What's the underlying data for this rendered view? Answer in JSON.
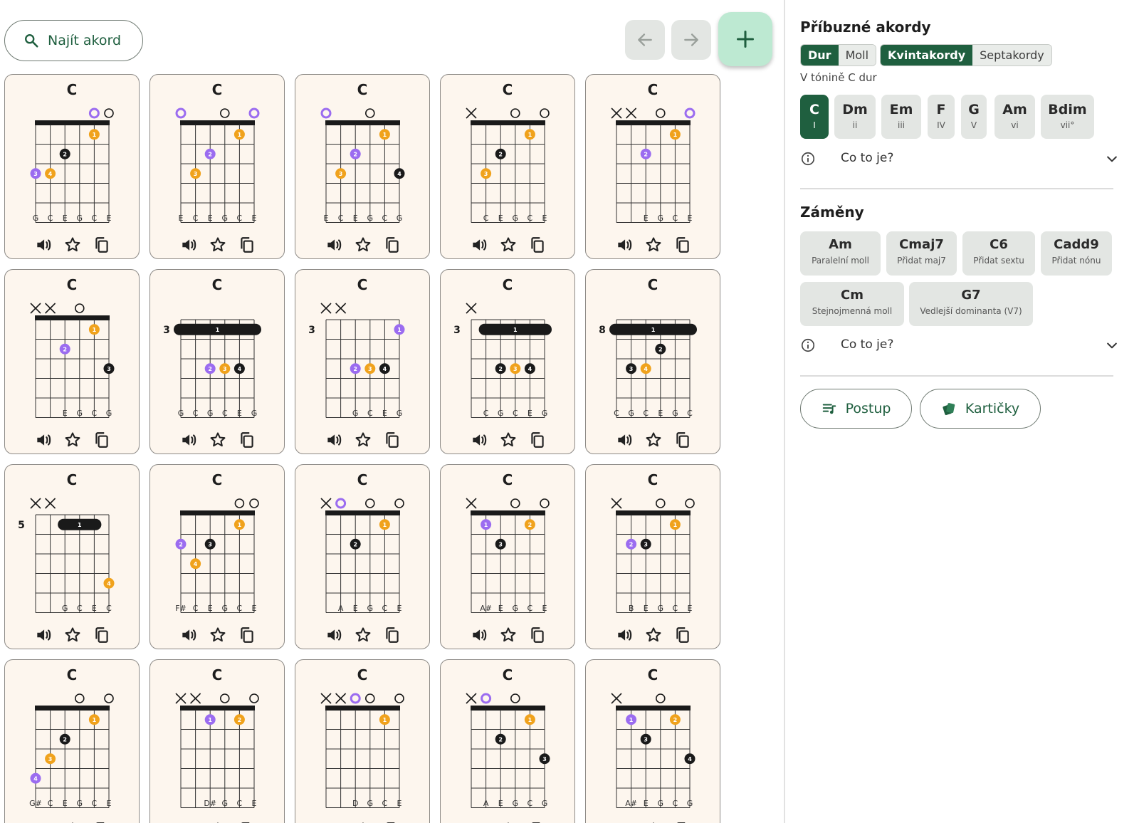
{
  "toolbar": {
    "search_label": "Najít akord",
    "search_icon": "magnifier-icon",
    "back_icon": "arrow-left-icon",
    "forward_icon": "arrow-right-icon",
    "add_icon": "plus-icon"
  },
  "colors": {
    "accent": "#1f5f3f",
    "finger_1": "#f0a21c",
    "finger_2": "#9b6cf0",
    "finger_3": "#1a1a1a",
    "open_root": "#9b6cf0",
    "card_bg": "#fdf6ee"
  },
  "chords": [
    {
      "name": "C",
      "base": "",
      "strings": [
        "G",
        "C",
        "E",
        "G",
        "C",
        "E"
      ],
      "top": [
        "",
        "",
        "",
        "",
        "R",
        "O"
      ],
      "barre": null,
      "dots": [
        {
          "s": 5,
          "f": 1,
          "n": "1",
          "c": "o"
        },
        {
          "s": 3,
          "f": 2,
          "n": "2",
          "c": "k"
        },
        {
          "s": 1,
          "f": 3,
          "n": "3",
          "c": "p"
        },
        {
          "s": 2,
          "f": 3,
          "n": "4",
          "c": "o"
        }
      ]
    },
    {
      "name": "C",
      "base": "",
      "strings": [
        "E",
        "C",
        "E",
        "G",
        "C",
        "E"
      ],
      "top": [
        "R",
        "",
        "",
        "O",
        "",
        "R"
      ],
      "barre": null,
      "dots": [
        {
          "s": 5,
          "f": 1,
          "n": "1",
          "c": "o"
        },
        {
          "s": 3,
          "f": 2,
          "n": "2",
          "c": "p"
        },
        {
          "s": 2,
          "f": 3,
          "n": "3",
          "c": "o"
        }
      ]
    },
    {
      "name": "C",
      "base": "",
      "strings": [
        "E",
        "C",
        "E",
        "G",
        "C",
        "G"
      ],
      "top": [
        "R",
        "",
        "",
        "O",
        "",
        ""
      ],
      "barre": null,
      "dots": [
        {
          "s": 5,
          "f": 1,
          "n": "1",
          "c": "o"
        },
        {
          "s": 3,
          "f": 2,
          "n": "2",
          "c": "p"
        },
        {
          "s": 2,
          "f": 3,
          "n": "3",
          "c": "o"
        },
        {
          "s": 6,
          "f": 3,
          "n": "4",
          "c": "k"
        }
      ]
    },
    {
      "name": "C",
      "base": "",
      "strings": [
        "",
        "C",
        "E",
        "G",
        "C",
        "E"
      ],
      "top": [
        "X",
        "",
        "",
        "O",
        "",
        "O"
      ],
      "barre": null,
      "dots": [
        {
          "s": 5,
          "f": 1,
          "n": "1",
          "c": "o"
        },
        {
          "s": 3,
          "f": 2,
          "n": "2",
          "c": "k"
        },
        {
          "s": 2,
          "f": 3,
          "n": "3",
          "c": "o"
        }
      ]
    },
    {
      "name": "C",
      "base": "",
      "strings": [
        "",
        "",
        "E",
        "G",
        "C",
        "E"
      ],
      "top": [
        "X",
        "X",
        "",
        "O",
        "",
        "R"
      ],
      "barre": null,
      "dots": [
        {
          "s": 5,
          "f": 1,
          "n": "1",
          "c": "o"
        },
        {
          "s": 3,
          "f": 2,
          "n": "2",
          "c": "p"
        }
      ]
    },
    {
      "name": "C",
      "base": "",
      "strings": [
        "",
        "",
        "E",
        "G",
        "C",
        "G"
      ],
      "top": [
        "X",
        "X",
        "",
        "O",
        "",
        ""
      ],
      "barre": null,
      "dots": [
        {
          "s": 5,
          "f": 1,
          "n": "1",
          "c": "o"
        },
        {
          "s": 3,
          "f": 2,
          "n": "2",
          "c": "p"
        },
        {
          "s": 6,
          "f": 3,
          "n": "3",
          "c": "k"
        }
      ]
    },
    {
      "name": "C",
      "base": "3",
      "strings": [
        "G",
        "C",
        "G",
        "C",
        "E",
        "G"
      ],
      "top": [
        "",
        "",
        "",
        "",
        "",
        ""
      ],
      "barre": {
        "from": 1,
        "to": 6,
        "f": 1,
        "n": "1"
      },
      "dots": [
        {
          "s": 3,
          "f": 3,
          "n": "2",
          "c": "p"
        },
        {
          "s": 4,
          "f": 3,
          "n": "3",
          "c": "o"
        },
        {
          "s": 5,
          "f": 3,
          "n": "4",
          "c": "k"
        }
      ]
    },
    {
      "name": "C",
      "base": "3",
      "strings": [
        "",
        "",
        "G",
        "C",
        "E",
        "G"
      ],
      "top": [
        "X",
        "X",
        "",
        "",
        "",
        ""
      ],
      "barre": null,
      "dots": [
        {
          "s": 6,
          "f": 1,
          "n": "1",
          "c": "p"
        },
        {
          "s": 3,
          "f": 3,
          "n": "2",
          "c": "p"
        },
        {
          "s": 4,
          "f": 3,
          "n": "3",
          "c": "o"
        },
        {
          "s": 5,
          "f": 3,
          "n": "4",
          "c": "k"
        }
      ]
    },
    {
      "name": "C",
      "base": "3",
      "strings": [
        "",
        "C",
        "G",
        "C",
        "E",
        "G"
      ],
      "top": [
        "X",
        "",
        "",
        "",
        "",
        ""
      ],
      "barre": {
        "from": 2,
        "to": 6,
        "f": 1,
        "n": "1"
      },
      "dots": [
        {
          "s": 3,
          "f": 3,
          "n": "2",
          "c": "k"
        },
        {
          "s": 4,
          "f": 3,
          "n": "3",
          "c": "o"
        },
        {
          "s": 5,
          "f": 3,
          "n": "4",
          "c": "k"
        }
      ]
    },
    {
      "name": "C",
      "base": "8",
      "strings": [
        "C",
        "G",
        "C",
        "E",
        "G",
        "C"
      ],
      "top": [
        "",
        "",
        "",
        "",
        "",
        ""
      ],
      "barre": {
        "from": 1,
        "to": 6,
        "f": 1,
        "n": "1"
      },
      "dots": [
        {
          "s": 4,
          "f": 2,
          "n": "2",
          "c": "k"
        },
        {
          "s": 2,
          "f": 3,
          "n": "3",
          "c": "k"
        },
        {
          "s": 3,
          "f": 3,
          "n": "4",
          "c": "o"
        }
      ]
    },
    {
      "name": "C",
      "base": "5",
      "strings": [
        "",
        "",
        "G",
        "C",
        "E",
        "C"
      ],
      "top": [
        "X",
        "X",
        "",
        "",
        "",
        ""
      ],
      "barre": {
        "from": 3,
        "to": 5,
        "f": 1,
        "n": "1"
      },
      "dots": [
        {
          "s": 6,
          "f": 4,
          "n": "4",
          "c": "o"
        }
      ]
    },
    {
      "name": "C",
      "base": "",
      "strings": [
        "F#",
        "C",
        "E",
        "G",
        "C",
        "E"
      ],
      "top": [
        "",
        "",
        "",
        "",
        "O",
        "O"
      ],
      "barre": null,
      "dots": [
        {
          "s": 5,
          "f": 1,
          "n": "1",
          "c": "o"
        },
        {
          "s": 1,
          "f": 2,
          "n": "2",
          "c": "p"
        },
        {
          "s": 3,
          "f": 2,
          "n": "3",
          "c": "k"
        },
        {
          "s": 2,
          "f": 3,
          "n": "4",
          "c": "o"
        }
      ]
    },
    {
      "name": "C",
      "base": "",
      "strings": [
        "",
        "A",
        "E",
        "G",
        "C",
        "E"
      ],
      "top": [
        "X",
        "R",
        "",
        "O",
        "",
        "O"
      ],
      "barre": null,
      "dots": [
        {
          "s": 5,
          "f": 1,
          "n": "1",
          "c": "o"
        },
        {
          "s": 3,
          "f": 2,
          "n": "2",
          "c": "k"
        }
      ]
    },
    {
      "name": "C",
      "base": "",
      "strings": [
        "",
        "A#",
        "E",
        "G",
        "C",
        "E"
      ],
      "top": [
        "X",
        "",
        "",
        "O",
        "",
        "O"
      ],
      "barre": null,
      "dots": [
        {
          "s": 2,
          "f": 1,
          "n": "1",
          "c": "p"
        },
        {
          "s": 5,
          "f": 1,
          "n": "2",
          "c": "o"
        },
        {
          "s": 3,
          "f": 2,
          "n": "3",
          "c": "k"
        }
      ]
    },
    {
      "name": "C",
      "base": "",
      "strings": [
        "",
        "B",
        "E",
        "G",
        "C",
        "E"
      ],
      "top": [
        "X",
        "",
        "",
        "O",
        "",
        "O"
      ],
      "barre": null,
      "dots": [
        {
          "s": 5,
          "f": 1,
          "n": "1",
          "c": "o"
        },
        {
          "s": 2,
          "f": 2,
          "n": "2",
          "c": "p"
        },
        {
          "s": 3,
          "f": 2,
          "n": "3",
          "c": "k"
        }
      ]
    },
    {
      "name": "C",
      "base": "",
      "strings": [
        "G#",
        "C",
        "E",
        "G",
        "C",
        "E"
      ],
      "top": [
        "",
        "",
        "",
        "O",
        "",
        "O"
      ],
      "barre": null,
      "dots": [
        {
          "s": 5,
          "f": 1,
          "n": "1",
          "c": "o"
        },
        {
          "s": 3,
          "f": 2,
          "n": "2",
          "c": "k"
        },
        {
          "s": 2,
          "f": 3,
          "n": "3",
          "c": "o"
        },
        {
          "s": 1,
          "f": 4,
          "n": "4",
          "c": "p"
        }
      ]
    },
    {
      "name": "C",
      "base": "",
      "strings": [
        "",
        "",
        "D#",
        "G",
        "C",
        "E"
      ],
      "top": [
        "X",
        "X",
        "",
        "O",
        "",
        "O"
      ],
      "barre": null,
      "dots": [
        {
          "s": 3,
          "f": 1,
          "n": "1",
          "c": "p"
        },
        {
          "s": 5,
          "f": 1,
          "n": "2",
          "c": "o"
        }
      ]
    },
    {
      "name": "C",
      "base": "",
      "strings": [
        "",
        "",
        "D",
        "G",
        "C",
        "E"
      ],
      "top": [
        "X",
        "X",
        "R",
        "O",
        "",
        "O"
      ],
      "barre": null,
      "dots": [
        {
          "s": 5,
          "f": 1,
          "n": "1",
          "c": "o"
        }
      ]
    },
    {
      "name": "C",
      "base": "",
      "strings": [
        "",
        "A",
        "E",
        "G",
        "C",
        "G"
      ],
      "top": [
        "X",
        "R",
        "",
        "O",
        "",
        ""
      ],
      "barre": null,
      "dots": [
        {
          "s": 5,
          "f": 1,
          "n": "1",
          "c": "o"
        },
        {
          "s": 3,
          "f": 2,
          "n": "2",
          "c": "k"
        },
        {
          "s": 6,
          "f": 3,
          "n": "3",
          "c": "k"
        }
      ]
    },
    {
      "name": "C",
      "base": "",
      "strings": [
        "",
        "A#",
        "E",
        "G",
        "C",
        "G"
      ],
      "top": [
        "X",
        "",
        "",
        "O",
        "",
        ""
      ],
      "barre": null,
      "dots": [
        {
          "s": 2,
          "f": 1,
          "n": "1",
          "c": "p"
        },
        {
          "s": 5,
          "f": 1,
          "n": "2",
          "c": "o"
        },
        {
          "s": 3,
          "f": 2,
          "n": "3",
          "c": "k"
        },
        {
          "s": 6,
          "f": 3,
          "n": "4",
          "c": "k"
        }
      ]
    }
  ],
  "card_action_icons": [
    "speaker-icon",
    "star-icon",
    "copy-icon"
  ],
  "related": {
    "title": "Příbuzné akordy",
    "toggle_mode": [
      "Dur",
      "Moll"
    ],
    "toggle_type": [
      "Kvintakordy",
      "Septakordy"
    ],
    "key_label": "V tónině C dur",
    "degrees": [
      {
        "chord": "C",
        "roman": "I"
      },
      {
        "chord": "Dm",
        "roman": "ii"
      },
      {
        "chord": "Em",
        "roman": "iii"
      },
      {
        "chord": "F",
        "roman": "IV"
      },
      {
        "chord": "G",
        "roman": "V"
      },
      {
        "chord": "Am",
        "roman": "vi"
      },
      {
        "chord": "Bdim",
        "roman": "vii°"
      }
    ],
    "info_label": "Co to je?"
  },
  "substitutions": {
    "title": "Záměny",
    "items": [
      {
        "chord": "Am",
        "desc": "Paralelní moll"
      },
      {
        "chord": "Cmaj7",
        "desc": "Přidat maj7"
      },
      {
        "chord": "C6",
        "desc": "Přidat sextu"
      },
      {
        "chord": "Cadd9",
        "desc": "Přidat nónu"
      },
      {
        "chord": "Cm",
        "desc": "Stejnojmenná moll"
      },
      {
        "chord": "G7",
        "desc": "Vedlejší dominanta (V7)"
      }
    ],
    "info_label": "Co to je?"
  },
  "actions": {
    "progression_label": "Postup",
    "cards_label": "Kartičky"
  }
}
